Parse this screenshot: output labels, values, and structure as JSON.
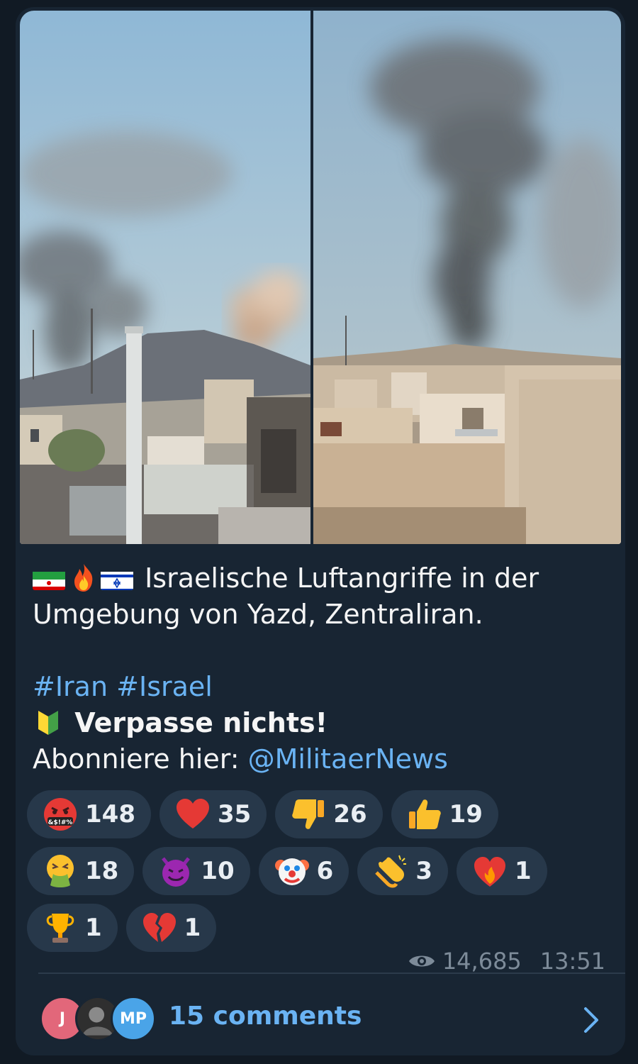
{
  "post": {
    "caption_line1": "Israelische Luftangriffe in der",
    "caption_line2": "Umgebung von Yazd, Zentraliran.",
    "hashtag1": "#Iran",
    "hashtag2": "#Israel",
    "cta_bold": "Verpasse nichts!",
    "cta_prefix": "Abonniere hier:",
    "mention": "@MilitaerNews",
    "emojis": [
      "flag-iran-icon",
      "fire-icon",
      "flag-israel-icon",
      "beginner-badge-icon"
    ]
  },
  "media": {
    "photos": [
      {
        "name": "smoke-photo-left",
        "icon": "photo-smoke-city"
      },
      {
        "name": "smoke-photo-right",
        "icon": "photo-smoke-plume"
      }
    ]
  },
  "reactions": [
    {
      "icon": "cursing-face-icon",
      "count": "148"
    },
    {
      "icon": "red-heart-icon",
      "count": "35"
    },
    {
      "icon": "thumbs-down-icon",
      "count": "26"
    },
    {
      "icon": "thumbs-up-icon",
      "count": "19"
    },
    {
      "icon": "vomiting-face-icon",
      "count": "18"
    },
    {
      "icon": "smiling-devil-icon",
      "count": "10"
    },
    {
      "icon": "clown-face-icon",
      "count": "6"
    },
    {
      "icon": "clapping-hands-icon",
      "count": "3"
    },
    {
      "icon": "heart-on-fire-icon",
      "count": "1"
    },
    {
      "icon": "trophy-icon",
      "count": "1"
    },
    {
      "icon": "broken-heart-icon",
      "count": "1"
    }
  ],
  "meta": {
    "views": "14,685",
    "time": "13:51"
  },
  "comments": {
    "label": "15 comments",
    "avatars": [
      "J",
      "",
      "MP"
    ]
  },
  "colors": {
    "bubble": "#182533",
    "link": "#6ab3f3",
    "chip": "#27384a"
  }
}
